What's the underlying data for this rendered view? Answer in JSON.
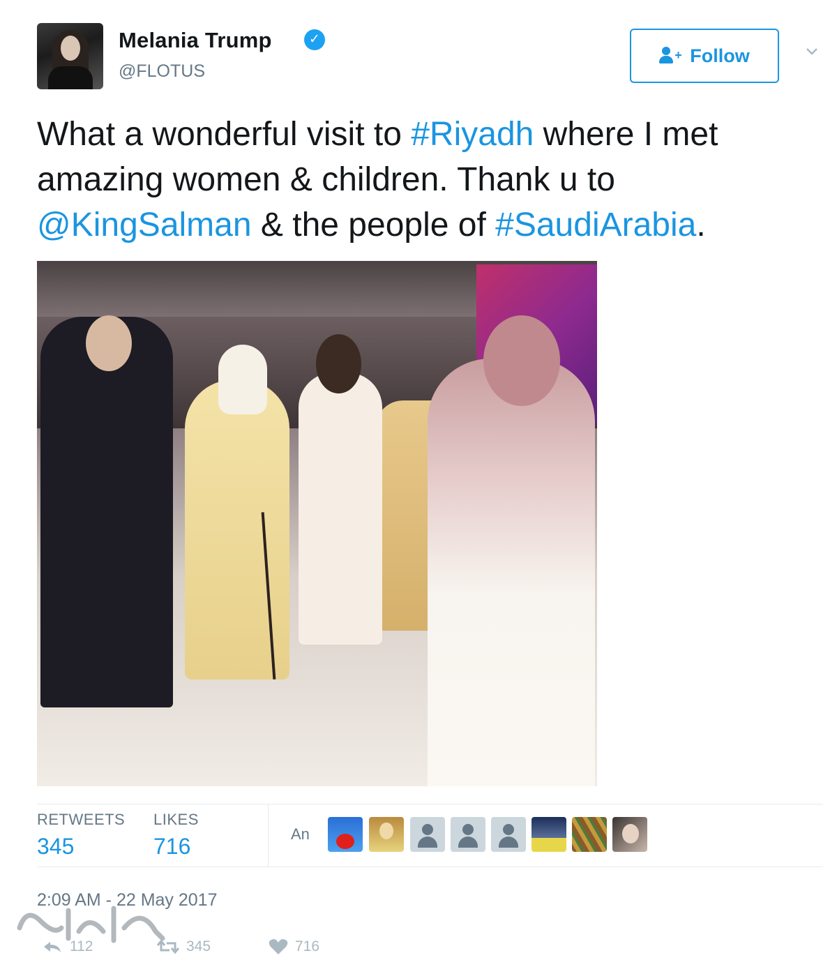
{
  "user": {
    "name": "Melania Trump",
    "handle": "@FLOTUS",
    "verified": true
  },
  "follow_button": {
    "label": "Follow"
  },
  "tweet": {
    "parts": [
      {
        "text": "What a wonderful visit to ",
        "link": false
      },
      {
        "text": "#Riyadh",
        "link": true
      },
      {
        "text": " where I met amazing women & children. Thank u to ",
        "link": false
      },
      {
        "text": "@KingSalman",
        "link": true
      },
      {
        "text": " & the people of ",
        "link": false
      },
      {
        "text": "#SaudiArabia",
        "link": true
      },
      {
        "text": ".",
        "link": false
      }
    ]
  },
  "stats": {
    "retweets_label": "RETWEETS",
    "retweets_value": "345",
    "likes_label": "LIKES",
    "likes_value": "716",
    "likers_label": "An"
  },
  "timestamp": "2:09 AM - 22 May 2017",
  "actions": {
    "replies": "112",
    "retweets": "345",
    "likes": "716"
  },
  "colors": {
    "link": "#1b95e0",
    "muted": "#657786",
    "text": "#14171a"
  },
  "icons": [
    "verified-badge-icon",
    "follow-person-icon",
    "chevron-down-icon",
    "reply-icon",
    "retweet-icon",
    "heart-icon"
  ]
}
